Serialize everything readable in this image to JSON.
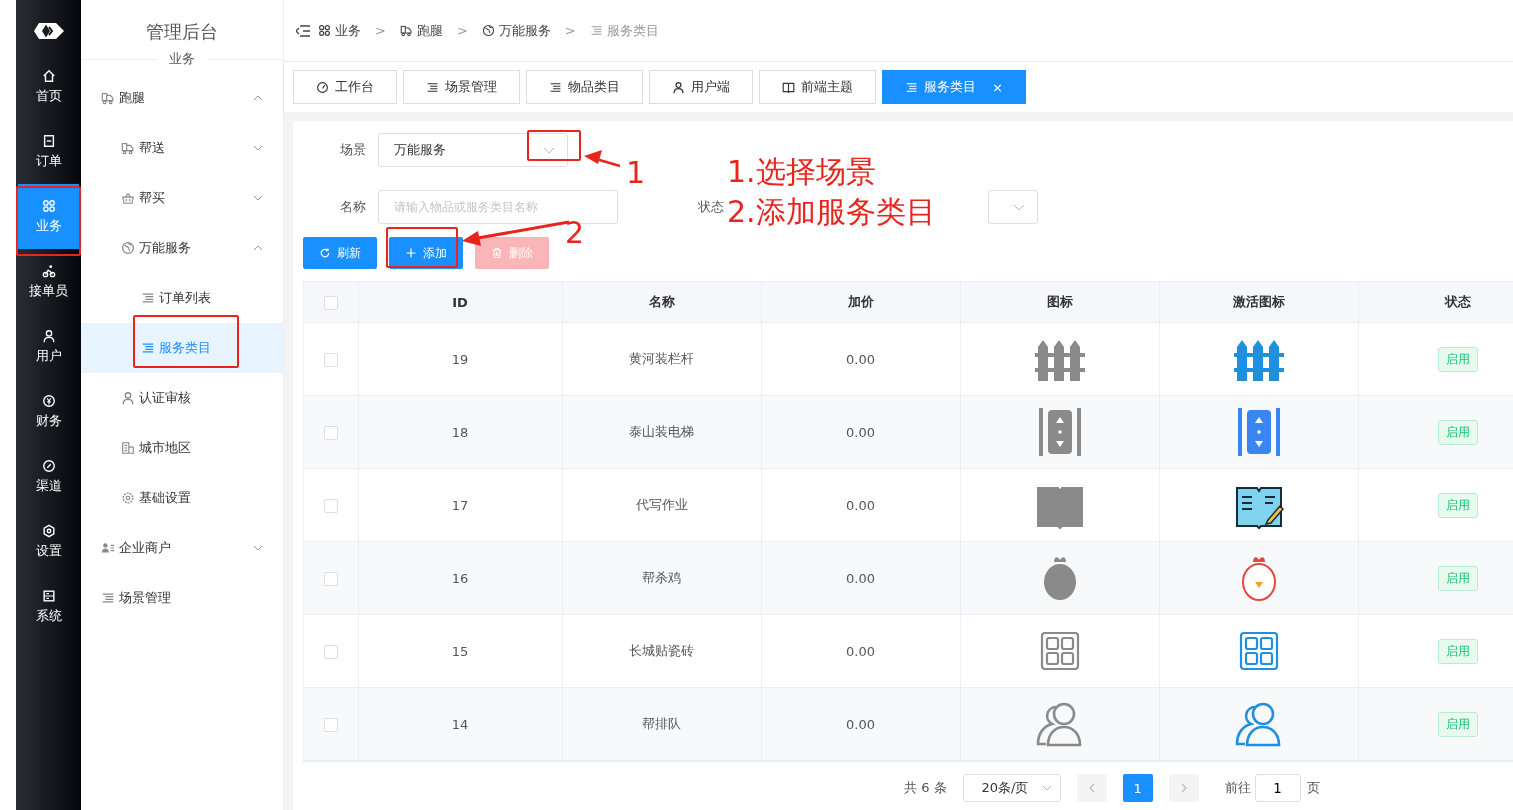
{
  "nav": [
    {
      "label": "首页",
      "kind": "home",
      "selected": false
    },
    {
      "label": "订单",
      "kind": "order",
      "selected": false
    },
    {
      "label": "业务",
      "kind": "grid",
      "selected": true
    },
    {
      "label": "接单员",
      "kind": "bike",
      "selected": false
    },
    {
      "label": "用户",
      "kind": "user",
      "selected": false
    },
    {
      "label": "财务",
      "kind": "coin",
      "selected": false
    },
    {
      "label": "渠道",
      "kind": "link",
      "selected": false
    },
    {
      "label": "设置",
      "kind": "hex",
      "selected": false
    },
    {
      "label": "系统",
      "kind": "system",
      "selected": false
    }
  ],
  "submenu": {
    "title": "管理后台",
    "section": "业务",
    "items": [
      {
        "label": "跑腿",
        "kind": "truck",
        "expanded": true,
        "selected": false,
        "children": [
          {
            "label": "帮送",
            "kind": "truck",
            "expanded": false,
            "selected": false
          },
          {
            "label": "帮买",
            "kind": "basket",
            "expanded": false,
            "selected": false
          },
          {
            "label": "万能服务",
            "kind": "globe",
            "expanded": true,
            "selected": false,
            "children": [
              {
                "label": "订单列表",
                "kind": "list",
                "selected": false
              },
              {
                "label": "服务类目",
                "kind": "list",
                "selected": true
              }
            ]
          },
          {
            "label": "认证审核",
            "kind": "user",
            "selected": false
          },
          {
            "label": "城市地区",
            "kind": "building",
            "selected": false
          },
          {
            "label": "基础设置",
            "kind": "gear",
            "selected": false
          }
        ]
      },
      {
        "label": "企业商户",
        "kind": "users",
        "expanded": false,
        "selected": false
      },
      {
        "label": "场景管理",
        "kind": "list",
        "selected": false
      }
    ]
  },
  "breadcrumb": [
    {
      "label": "业务",
      "kind": "grid"
    },
    {
      "separator": ">",
      "label": "跑腿",
      "kind": "truck"
    },
    {
      "separator": ">",
      "label": "万能服务",
      "kind": "globe"
    },
    {
      "separator": ">",
      "label": "服务类目",
      "kind": "list"
    }
  ],
  "tabs": [
    {
      "label": "工作台",
      "kind": "gauge",
      "selected": false
    },
    {
      "label": "场景管理",
      "kind": "list",
      "selected": false
    },
    {
      "label": "物品类目",
      "kind": "list",
      "selected": false
    },
    {
      "label": "用户端",
      "kind": "user",
      "selected": false
    },
    {
      "label": "前端主题",
      "kind": "book",
      "selected": false
    },
    {
      "label": "服务类目",
      "kind": "list",
      "selected": true,
      "close": "×"
    }
  ],
  "filters": {
    "scene_label": "场景",
    "scene_value": "万能服务",
    "name_label": "名称",
    "name_placeholder": "请输入物品或服务类目名称",
    "status_label": "状态"
  },
  "buttons": [
    {
      "label": "刷新",
      "kind": "refresh",
      "disabled": false
    },
    {
      "label": "添加",
      "kind": "add",
      "disabled": false
    },
    {
      "label": "删除",
      "kind": "delete",
      "disabled": true
    }
  ],
  "table": {
    "all_checked": false,
    "columns": [
      "ID",
      "名称",
      "加价",
      "图标",
      "激活图标",
      "状态"
    ],
    "rows": [
      {
        "checked": false,
        "id": "19",
        "name": "黄河装栏杆",
        "price": "0.00",
        "kind": "fence",
        "status": "启用"
      },
      {
        "checked": false,
        "id": "18",
        "name": "泰山装电梯",
        "price": "0.00",
        "kind": "elevator",
        "status": "启用"
      },
      {
        "checked": false,
        "id": "17",
        "name": "代写作业",
        "price": "0.00",
        "kind": "book",
        "status": "启用"
      },
      {
        "checked": false,
        "id": "16",
        "name": "帮杀鸡",
        "price": "0.00",
        "kind": "chicken",
        "status": "启用"
      },
      {
        "checked": false,
        "id": "15",
        "name": "长城贴瓷砖",
        "price": "0.00",
        "kind": "tiles",
        "status": "启用"
      },
      {
        "checked": false,
        "id": "14",
        "name": "帮排队",
        "price": "0.00",
        "kind": "people",
        "status": "启用"
      }
    ]
  },
  "pagination": {
    "total": "共 6 条",
    "page_size": "20条/页",
    "pages": [
      {
        "label": "1",
        "selected": true
      }
    ],
    "goto_label": "前往",
    "goto_value": "1",
    "goto_suffix": "页"
  },
  "annotations": {
    "step_one": "1",
    "step_two": "2",
    "notes": [
      "1.选择场景",
      "2.添加服务类目"
    ]
  }
}
